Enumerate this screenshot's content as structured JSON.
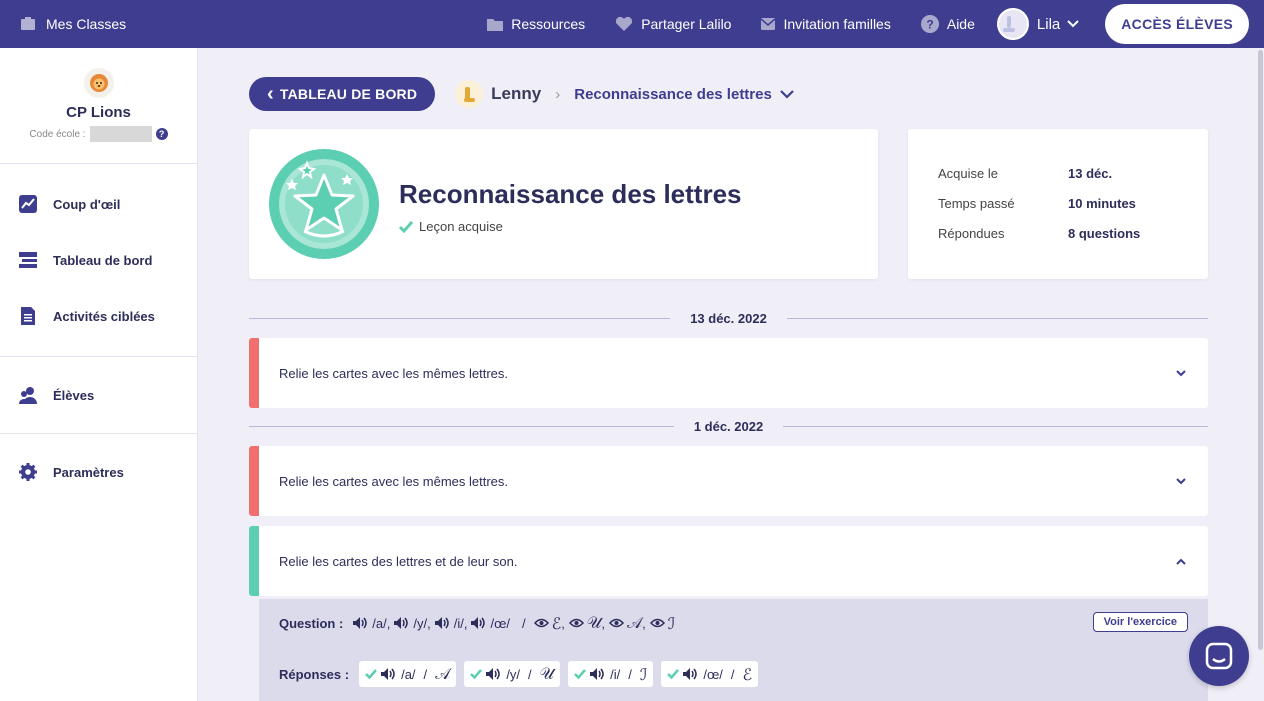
{
  "topbar": {
    "classes_label": "Mes Classes",
    "nav": {
      "ressources": "Ressources",
      "partager": "Partager Lalilo",
      "invitation": "Invitation familles",
      "aide": "Aide"
    },
    "user_name": "Lila",
    "eleves_button": "ACCÈS ÉLÈVES"
  },
  "sidebar": {
    "class_name": "CP Lions",
    "code_label": "Code école :",
    "help": "?",
    "items": [
      {
        "label": "Coup d'œil"
      },
      {
        "label": "Tableau de bord"
      },
      {
        "label": "Activités ciblées"
      },
      {
        "label": "Élèves"
      },
      {
        "label": "Paramètres"
      }
    ]
  },
  "breadcrumb": {
    "back_label": "TABLEAU DE BORD",
    "back_arrow": "‹",
    "student": "Lenny",
    "separator": "›",
    "lesson": "Reconnaissance des lettres"
  },
  "lesson": {
    "title": "Reconnaissance des lettres",
    "status": "Leçon acquise"
  },
  "stats": {
    "acquired_label": "Acquise le",
    "acquired_value": "13 déc.",
    "time_label": "Temps passé",
    "time_value": "10 minutes",
    "answered_label": "Répondues",
    "answered_value": "8 questions"
  },
  "dates": {
    "first": "13 déc. 2022",
    "second": "1 déc. 2022"
  },
  "exercises": [
    {
      "text": "Relie les cartes avec les mêmes lettres.",
      "status": "failed"
    },
    {
      "text": "Relie les cartes avec les mêmes lettres.",
      "status": "failed"
    },
    {
      "text": "Relie les cartes des lettres et de leur son.",
      "status": "success"
    }
  ],
  "details": {
    "question_label": "Question :",
    "questions": [
      "/a/",
      "/y/",
      "/i/",
      "/œ/"
    ],
    "glyphs": [
      "ℰ",
      "𝒰",
      "𝒜",
      "ℐ"
    ],
    "slash": "/",
    "comma": ",",
    "voir_button": "Voir l'exercice",
    "answers_label": "Réponses :",
    "answers": [
      {
        "sound": "/a/",
        "glyph": "𝒜"
      },
      {
        "sound": "/y/",
        "glyph": "𝒰"
      },
      {
        "sound": "/i/",
        "glyph": "ℐ"
      },
      {
        "sound": "/œ/",
        "glyph": "ℰ"
      }
    ]
  },
  "colors": {
    "primary": "#3f3d8f",
    "failed": "#f26f6f",
    "success": "#5ccfb3"
  }
}
